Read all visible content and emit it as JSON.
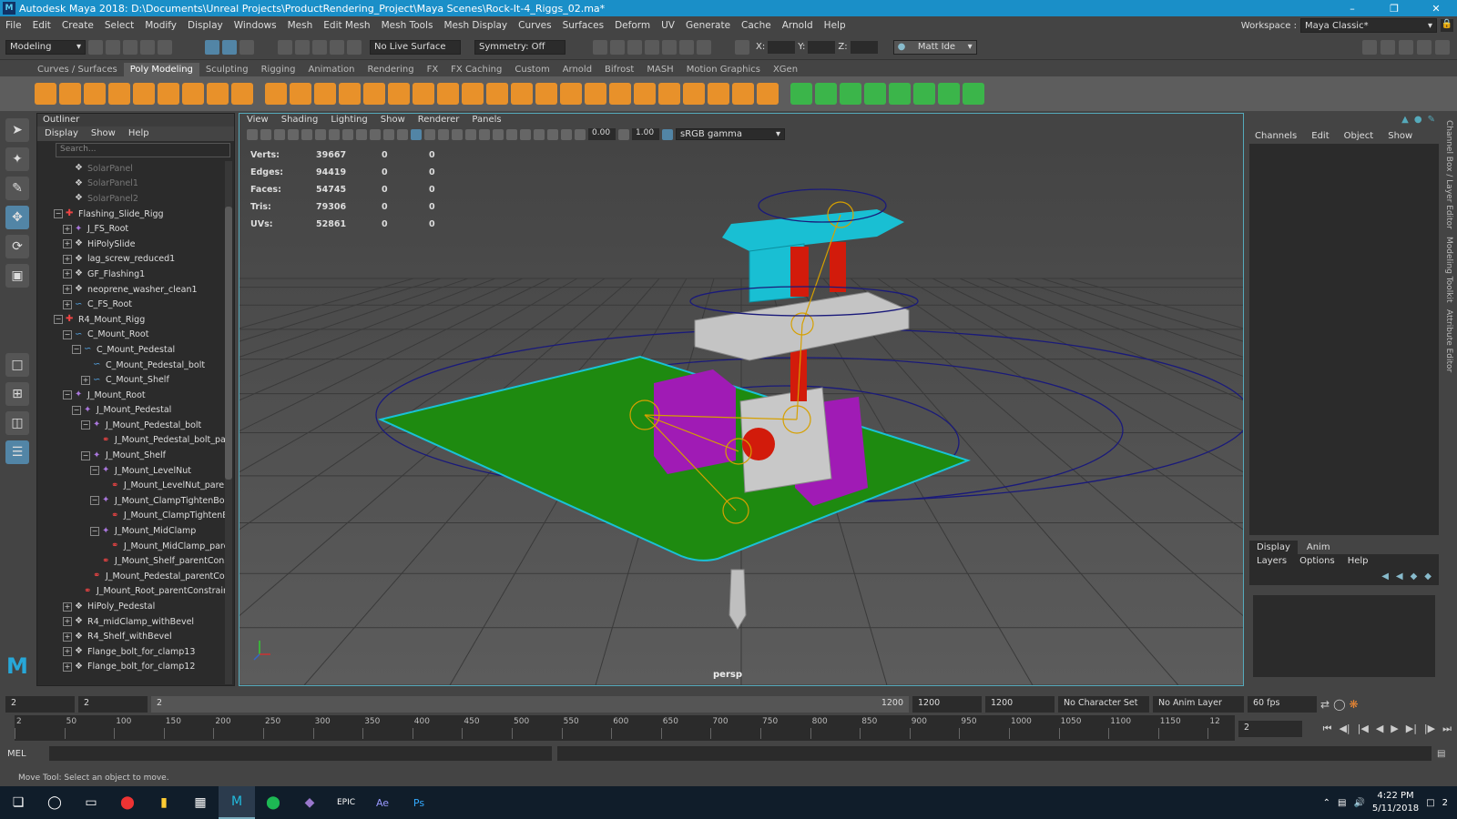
{
  "window": {
    "title": "Autodesk Maya 2018: D:\\Documents\\Unreal Projects\\ProductRendering_Project\\Maya Scenes\\Rock-It-4_Riggs_02.ma*"
  },
  "menu": [
    "File",
    "Edit",
    "Create",
    "Select",
    "Modify",
    "Display",
    "Windows",
    "Mesh",
    "Edit Mesh",
    "Mesh Tools",
    "Mesh Display",
    "Curves",
    "Surfaces",
    "Deform",
    "UV",
    "Generate",
    "Cache",
    "Arnold",
    "Help"
  ],
  "workspace": {
    "label": "Workspace :",
    "value": "Maya Classic*"
  },
  "status": {
    "mode": "Modeling",
    "live_surface": "No Live Surface",
    "symmetry": "Symmetry: Off",
    "x": "X:",
    "y": "Y:",
    "z": "Z:",
    "user": "Matt Ide"
  },
  "shelf_tabs": [
    "Curves / Surfaces",
    "Poly Modeling",
    "Sculpting",
    "Rigging",
    "Animation",
    "Rendering",
    "FX",
    "FX Caching",
    "Custom",
    "Arnold",
    "Bifrost",
    "MASH",
    "Motion Graphics",
    "XGen"
  ],
  "shelf_icon_colors": [
    "#e8912a",
    "#e8912a",
    "#e8912a",
    "#e8912a",
    "#e8912a",
    "#e8912a",
    "#e8912a",
    "#e8912a",
    "#e8912a",
    "#e8912a",
    "#e8912a",
    "#e8912a",
    "#e8912a",
    "#e8912a",
    "#e8912a",
    "#e8912a",
    "#e8912a",
    "#e8912a",
    "#e8912a",
    "#e8912a",
    "#e8912a",
    "#e8912a",
    "#e8912a",
    "#e8912a",
    "#e8912a",
    "#e8912a",
    "#e8912a",
    "#e8912a",
    "#e8912a",
    "#e8912a",
    "#3bb54a",
    "#3bb54a",
    "#3bb54a",
    "#3bb54a",
    "#3bb54a",
    "#3bb54a",
    "#3bb54a",
    "#3bb54a"
  ],
  "outliner": {
    "title": "Outliner",
    "menu": [
      "Display",
      "Show",
      "Help"
    ],
    "search_placeholder": "Search...",
    "rows": [
      {
        "label": "SolarPanel",
        "indent": 2,
        "icon": "mesh",
        "exp": "none",
        "dim": true
      },
      {
        "label": "SolarPanel1",
        "indent": 2,
        "icon": "mesh",
        "exp": "none",
        "dim": true
      },
      {
        "label": "SolarPanel2",
        "indent": 2,
        "icon": "mesh",
        "exp": "none",
        "dim": true
      },
      {
        "label": "Flashing_Slide_Rigg",
        "indent": 1,
        "icon": "rig",
        "exp": "-"
      },
      {
        "label": "J_FS_Root",
        "indent": 2,
        "icon": "joint",
        "exp": "+"
      },
      {
        "label": "HiPolySlide",
        "indent": 2,
        "icon": "mesh",
        "exp": "+"
      },
      {
        "label": "lag_screw_reduced1",
        "indent": 2,
        "icon": "mesh",
        "exp": "+"
      },
      {
        "label": "GF_Flashing1",
        "indent": 2,
        "icon": "mesh",
        "exp": "+"
      },
      {
        "label": "neoprene_washer_clean1",
        "indent": 2,
        "icon": "mesh",
        "exp": "+"
      },
      {
        "label": "C_FS_Root",
        "indent": 2,
        "icon": "curve",
        "exp": "+"
      },
      {
        "label": "R4_Mount_Rigg",
        "indent": 1,
        "icon": "rig",
        "exp": "-"
      },
      {
        "label": "C_Mount_Root",
        "indent": 2,
        "icon": "curve",
        "exp": "-"
      },
      {
        "label": "C_Mount_Pedestal",
        "indent": 3,
        "icon": "curve",
        "exp": "-"
      },
      {
        "label": "C_Mount_Pedestal_bolt",
        "indent": 4,
        "icon": "curve",
        "exp": "none"
      },
      {
        "label": "C_Mount_Shelf",
        "indent": 4,
        "icon": "curve",
        "exp": "+"
      },
      {
        "label": "J_Mount_Root",
        "indent": 2,
        "icon": "joint",
        "exp": "-"
      },
      {
        "label": "J_Mount_Pedestal",
        "indent": 3,
        "icon": "joint",
        "exp": "-"
      },
      {
        "label": "J_Mount_Pedestal_bolt",
        "indent": 4,
        "icon": "joint",
        "exp": "-"
      },
      {
        "label": "J_Mount_Pedestal_bolt_par",
        "indent": 5,
        "icon": "constraint",
        "exp": "none"
      },
      {
        "label": "J_Mount_Shelf",
        "indent": 4,
        "icon": "joint",
        "exp": "-"
      },
      {
        "label": "J_Mount_LevelNut",
        "indent": 5,
        "icon": "joint",
        "exp": "-"
      },
      {
        "label": "J_Mount_LevelNut_parent",
        "indent": 6,
        "icon": "constraint",
        "exp": "none"
      },
      {
        "label": "J_Mount_ClampTightenBolt",
        "indent": 5,
        "icon": "joint",
        "exp": "-"
      },
      {
        "label": "J_Mount_ClampTightenB",
        "indent": 6,
        "icon": "constraint",
        "exp": "none"
      },
      {
        "label": "J_Mount_MidClamp",
        "indent": 5,
        "icon": "joint",
        "exp": "-"
      },
      {
        "label": "J_Mount_MidClamp_pare",
        "indent": 6,
        "icon": "constraint",
        "exp": "none"
      },
      {
        "label": "J_Mount_Shelf_parentConst",
        "indent": 5,
        "icon": "constraint",
        "exp": "none"
      },
      {
        "label": "J_Mount_Pedestal_parentCon",
        "indent": 4,
        "icon": "constraint",
        "exp": "none"
      },
      {
        "label": "J_Mount_Root_parentConstraint",
        "indent": 3,
        "icon": "constraint",
        "exp": "none"
      },
      {
        "label": "HiPoly_Pedestal",
        "indent": 2,
        "icon": "mesh",
        "exp": "+"
      },
      {
        "label": "R4_midClamp_withBevel",
        "indent": 2,
        "icon": "mesh",
        "exp": "+"
      },
      {
        "label": "R4_Shelf_withBevel",
        "indent": 2,
        "icon": "mesh",
        "exp": "+"
      },
      {
        "label": "Flange_bolt_for_clamp13",
        "indent": 2,
        "icon": "mesh",
        "exp": "+"
      },
      {
        "label": "Flange_bolt_for_clamp12",
        "indent": 2,
        "icon": "mesh",
        "exp": "+"
      }
    ]
  },
  "viewport": {
    "menu": [
      "View",
      "Shading",
      "Lighting",
      "Show",
      "Renderer",
      "Panels"
    ],
    "val1": "0.00",
    "val2": "1.00",
    "color_space": "sRGB gamma",
    "camera": "persp",
    "hud": [
      {
        "name": "Verts:",
        "v": "39667",
        "a": "0",
        "b": "0"
      },
      {
        "name": "Edges:",
        "v": "94419",
        "a": "0",
        "b": "0"
      },
      {
        "name": "Faces:",
        "v": "54745",
        "a": "0",
        "b": "0"
      },
      {
        "name": "Tris:",
        "v": "79306",
        "a": "0",
        "b": "0"
      },
      {
        "name": "UVs:",
        "v": "52861",
        "a": "0",
        "b": "0"
      }
    ]
  },
  "channel_box": {
    "menu": [
      "Channels",
      "Edit",
      "Object",
      "Show"
    ]
  },
  "layers": {
    "tabs": [
      "Display",
      "Anim"
    ],
    "menu": [
      "Layers",
      "Options",
      "Help"
    ]
  },
  "side_tabs": [
    "Channel Box / Layer Editor",
    "Modeling Toolkit",
    "Attribute Editor"
  ],
  "range": {
    "start": "2",
    "anim_start": "2",
    "slider_start": "2",
    "slider_end": "1200",
    "end": "1200",
    "anim_end": "1200",
    "character": "No Character Set",
    "anim_layer": "No Anim Layer",
    "fps": "60 fps"
  },
  "timeline": {
    "ticks": [
      "2",
      "50",
      "100",
      "150",
      "200",
      "250",
      "300",
      "350",
      "400",
      "450",
      "500",
      "550",
      "600",
      "650",
      "700",
      "750",
      "800",
      "850",
      "900",
      "950",
      "1000",
      "1050",
      "1100",
      "1150",
      "12"
    ],
    "current": "2"
  },
  "cmd": {
    "label": "MEL"
  },
  "help_line": "Move Tool: Select an object to move.",
  "taskbar": {
    "time": "4:22 PM",
    "date": "5/11/2018",
    "notif": "2"
  }
}
